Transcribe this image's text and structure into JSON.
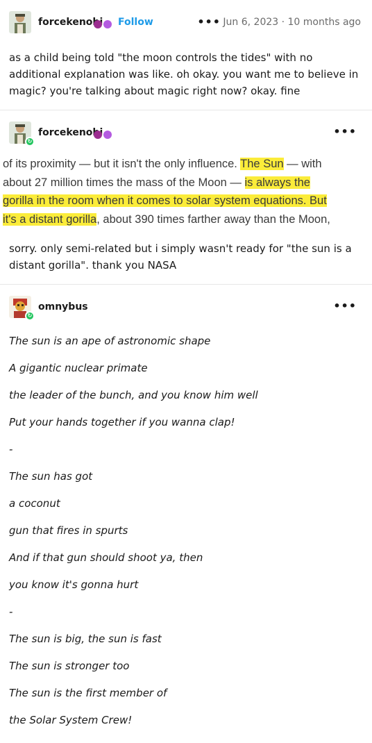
{
  "post1": {
    "username": "forcekenobi",
    "follow_label": "Follow",
    "menu": "•••",
    "date": "Jun 6, 2023 · 10 months ago",
    "text": "as a child being told \"the moon controls the tides\" with no additional explanation was like. oh okay. you want me to believe in magic? you're talking about magic right now? okay. fine"
  },
  "post2": {
    "username": "forcekenobi",
    "menu": "•••",
    "quote_lines": [
      {
        "pre": "of its proximity — but it isn't the only influence. ",
        "hl": "The Sun",
        "post": " — with"
      },
      {
        "pre": "about 27 million times the mass of the Moon — ",
        "hl": "is always the",
        "post": ""
      },
      {
        "pre": "",
        "hl": "gorilla in the room when it comes to solar system equations. But",
        "post": ""
      },
      {
        "pre": "",
        "hl": "it's a distant gorilla",
        "post": ", about 390 times farther away than the Moon,"
      }
    ],
    "text": "sorry. only semi-related but i simply wasn't ready for \"the sun is a distant gorilla\". thank you NASA"
  },
  "post3": {
    "username": "omnybus",
    "menu": "•••",
    "poem": [
      "The sun is an ape of astronomic shape",
      "A gigantic nuclear primate",
      "the leader of the bunch, and you know him well",
      "Put your hands together if you wanna clap!",
      "-",
      "The sun has got",
      "a coconut",
      "gun that fires in spurts",
      "And if that gun should shoot ya, then",
      "you know it's gonna hurt",
      "-",
      "The sun is big, the sun is fast",
      "The sun is stronger too",
      "The sun is the first member of",
      "the Solar System Crew!"
    ]
  },
  "colors": {
    "link": "#1e9be8",
    "highlight": "#fbec3a",
    "reblog_badge": "#22c55e"
  }
}
